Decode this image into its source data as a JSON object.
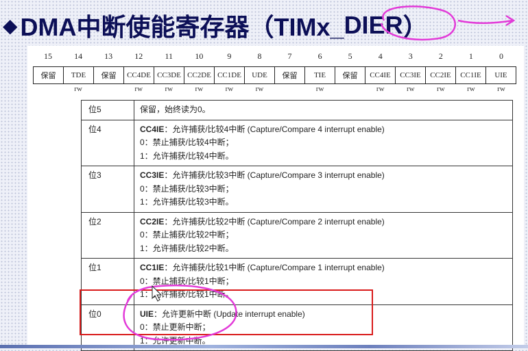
{
  "title": {
    "diamond": "◆",
    "prefix": "DMA中断使能寄存器（TIMx_",
    "highlight": "DIER",
    "suffix": "）"
  },
  "bit_numbers": [
    "15",
    "14",
    "13",
    "12",
    "11",
    "10",
    "9",
    "8",
    "7",
    "6",
    "5",
    "4",
    "3",
    "2",
    "1",
    "0"
  ],
  "register_fields": [
    "保留",
    "TDE",
    "保留",
    "CC4DE",
    "CC3DE",
    "CC2DE",
    "CC1DE",
    "UDE",
    "保留",
    "TIE",
    "保留",
    "CC4IE",
    "CC3IE",
    "CC2IE",
    "CC1IE",
    "UIE"
  ],
  "access": [
    "",
    "rw",
    "",
    "rw",
    "rw",
    "rw",
    "rw",
    "rw",
    "",
    "rw",
    "",
    "rw",
    "rw",
    "rw",
    "rw",
    "rw"
  ],
  "descriptions": [
    {
      "bit": "位5",
      "head": "",
      "text": "保留，始终读为0。",
      "opt0": "",
      "opt1": ""
    },
    {
      "bit": "位4",
      "head": "CC4IE",
      "text": "：允许捕获/比较4中断 (Capture/Compare 4 interrupt enable)",
      "opt0": "0：禁止捕获/比较4中断；",
      "opt1": "1：允许捕获/比较4中断。"
    },
    {
      "bit": "位3",
      "head": "CC3IE",
      "text": "：允许捕获/比较3中断 (Capture/Compare 3 interrupt enable)",
      "opt0": "0：禁止捕获/比较3中断；",
      "opt1": "1：允许捕获/比较3中断。"
    },
    {
      "bit": "位2",
      "head": "CC2IE",
      "text": "：允许捕获/比较2中断 (Capture/Compare 2 interrupt enable)",
      "opt0": "0：禁止捕获/比较2中断；",
      "opt1": "1：允许捕获/比较2中断。"
    },
    {
      "bit": "位1",
      "head": "CC1IE",
      "text": "：允许捕获/比较1中断 (Capture/Compare 1 interrupt enable)",
      "opt0": "0：禁止捕获/比较1中断；",
      "opt1": "1：允许捕获/比较1中断。"
    },
    {
      "bit": "位0",
      "head": "UIE",
      "text": "：允许更新中断 (Update interrupt enable)",
      "opt0": "0：禁止更新中断；",
      "opt1": "1：允许更新中断。"
    }
  ],
  "colors": {
    "title": "#0c0f57",
    "annotation": "#e23ad8",
    "highlight_box": "#d91a1a"
  }
}
